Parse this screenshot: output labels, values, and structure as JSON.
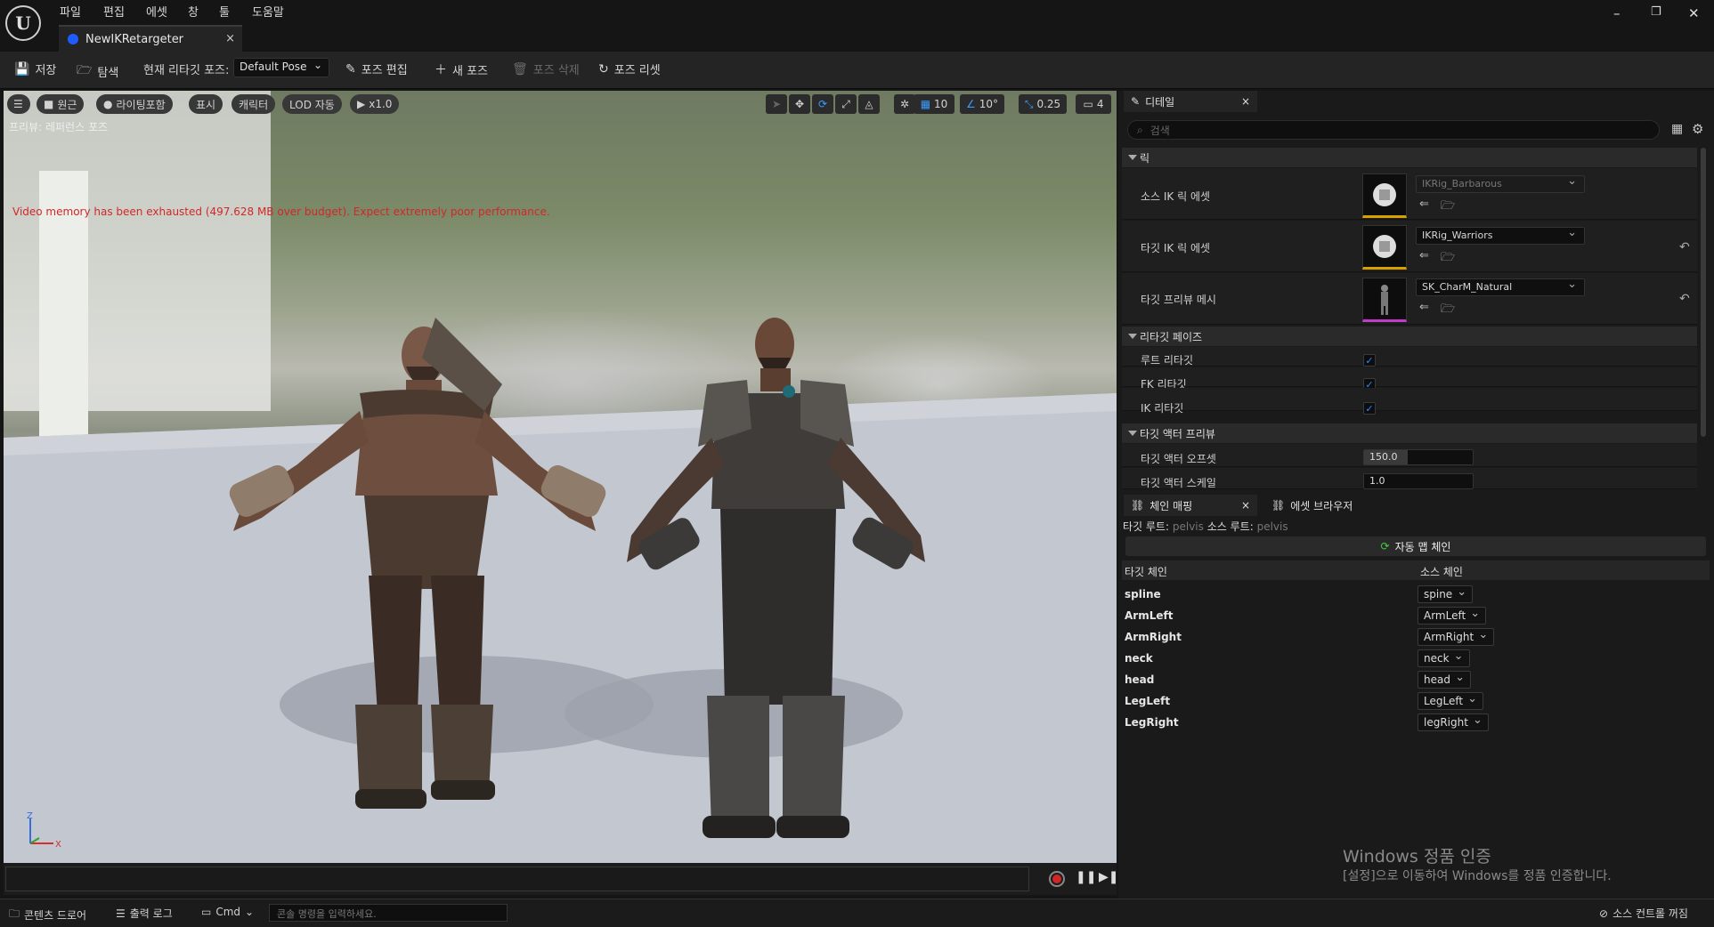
{
  "app": {
    "menu": [
      "파일",
      "편집",
      "에셋",
      "창",
      "툴",
      "도움말"
    ],
    "tab_title": "NewIKRetargeter",
    "tab_close": "×",
    "window_controls": [
      "–",
      "❐",
      "✕"
    ]
  },
  "toolbar": {
    "save": "저장",
    "browse": "탐색",
    "current_pose_label": "현재 리타깃 포즈:",
    "current_pose_value": "Default Pose",
    "edit_pose": "포즈 편집",
    "new_pose": "새 포즈",
    "delete_pose": "포즈 삭제",
    "reset_pose": "포즈 리셋"
  },
  "viewport": {
    "menu_icon": "☰",
    "perspective": "원근",
    "lighting": "라이팅포함",
    "show": "표시",
    "character": "캐릭터",
    "lod": "LOD 자동",
    "play_speed": "x1.0",
    "grid_snap": "10",
    "rotation_snap": "10°",
    "scale_snap": "0.25",
    "camera_speed": "4",
    "preview_label": "프리뷰: 레퍼런스 포즈",
    "warning": "Video memory has been exhausted (497.628 MB over budget). Expect extremely poor performance.",
    "axis_z": "Z",
    "axis_x": "X"
  },
  "details": {
    "title": "디테일",
    "close": "×",
    "search_placeholder": "검색",
    "sections": {
      "rig": "릭",
      "retarget_phases": "리타깃 페이즈",
      "target_actor_preview": "타깃 액터 프리뷰"
    },
    "source_ik_label": "소스 IK 릭 에셋",
    "source_ik_value": "IKRig_Barbarous",
    "target_ik_label": "타깃 IK 릭 에셋",
    "target_ik_value": "IKRig_Warriors",
    "target_mesh_label": "타깃 프리뷰 메시",
    "target_mesh_value": "SK_CharM_Natural",
    "root_retarget": "루트 리타깃",
    "fk_retarget": "FK 리타깃",
    "ik_retarget": "IK 리타깃",
    "offset_label": "타깃 액터 오프셋",
    "offset_value": "150.0",
    "offset_fill": 0.4,
    "scale_label": "타깃 액터 스케일",
    "scale_value": "1.0"
  },
  "chain_mapping": {
    "tab": "체인 매핑",
    "close": "×",
    "asset_browser_tab": "에셋 브라우저",
    "target_root_label": "타깃 루트:",
    "target_root_value": "pelvis",
    "source_root_label": "소스 루트:",
    "source_root_value": "pelvis",
    "auto_map": "자동 맵 체인",
    "col_target": "타깃 체인",
    "col_source": "소스 체인",
    "rows": [
      {
        "target": "spline",
        "source": "spine"
      },
      {
        "target": "ArmLeft",
        "source": "ArmLeft"
      },
      {
        "target": "ArmRight",
        "source": "ArmRight"
      },
      {
        "target": "neck",
        "source": "neck"
      },
      {
        "target": "head",
        "source": "head"
      },
      {
        "target": "LegLeft",
        "source": "LegLeft"
      },
      {
        "target": "LegRight",
        "source": "legRight"
      }
    ]
  },
  "statusbar": {
    "content_drawer": "콘텐츠 드로어",
    "output_log": "출력 로그",
    "cmd": "Cmd",
    "console_placeholder": "콘솔 명령을 입력하세요.",
    "source_control": "소스 컨트롤 꺼짐"
  },
  "watermark": {
    "line1": "Windows 정품 인증",
    "line2": "[설정]으로 이동하여 Windows를 정품 인증합니다."
  }
}
